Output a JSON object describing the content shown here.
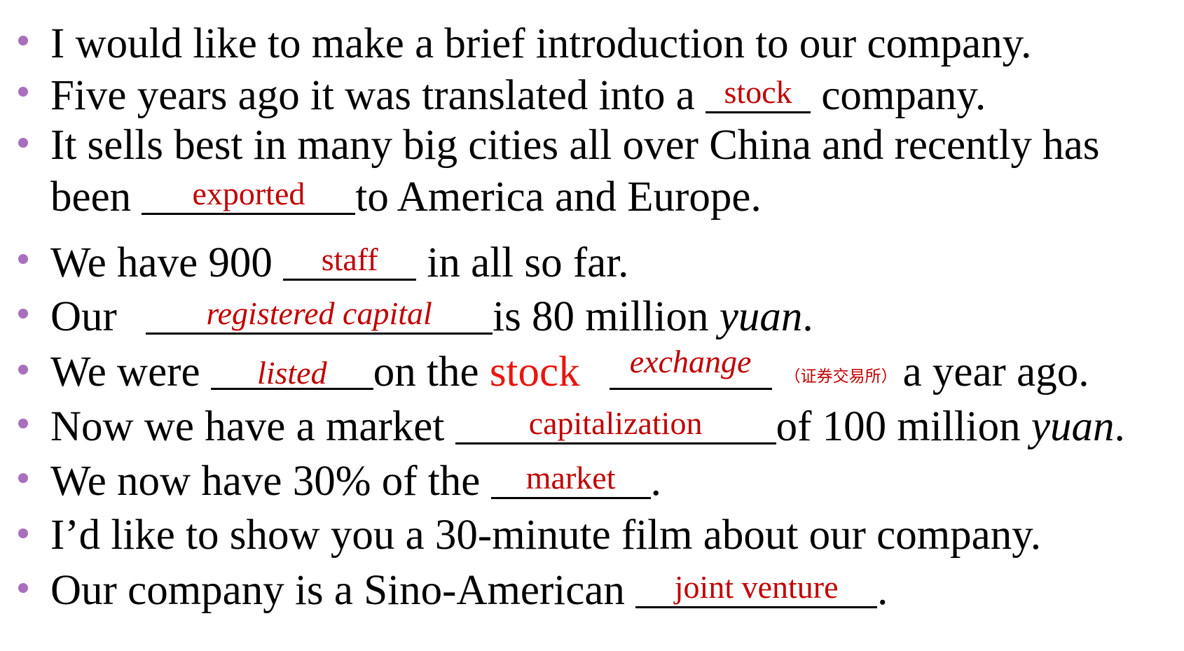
{
  "sentences": {
    "s1": {
      "text": "I would like to make a brief introduction to our company."
    },
    "s2": {
      "before": "Five years ago it was translated into a ",
      "answer": "stock",
      "after": " company."
    },
    "s3": {
      "line1": "It sells best in many big cities all over China and recently has",
      "before": "been ",
      "answer": "exported",
      "after": "to America and Europe."
    },
    "s4": {
      "before": "We have 900 ",
      "answer": "staff",
      "after": " in all so far."
    },
    "s5": {
      "before": "Our ",
      "answer": "registered capital",
      "after": "is 80 million ",
      "italic": "yuan",
      "end": "."
    },
    "s6": {
      "before": "We were ",
      "answer": "listed",
      "middle": "on the ",
      "red_word": "stock",
      "answer2": "exchange",
      "note": "（证券交易所）",
      "after": "a year ago."
    },
    "s7": {
      "before": "Now we have a market ",
      "answer": "capitalization",
      "after": "of 100 million ",
      "italic": "yuan",
      "end": "."
    },
    "s8": {
      "before": "We now have 30% of the ",
      "answer": "market",
      "after": "."
    },
    "s9": {
      "text": "I’d like to show you a 30-minute film about our company."
    },
    "s10": {
      "before": "Our company is a Sino-American ",
      "answer": "joint venture",
      "after": "."
    }
  },
  "colors": {
    "bullet": "#a86fbd",
    "answer": "#c00000",
    "highlight": "#e8160f"
  }
}
